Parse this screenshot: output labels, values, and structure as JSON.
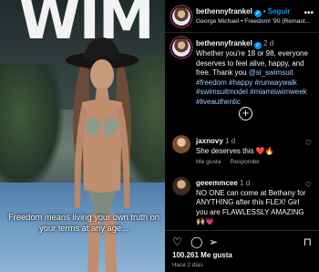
{
  "media": {
    "big_text": "WIM",
    "overlay_caption": "Freedom means living your own truth on your terms at any age..."
  },
  "post": {
    "username": "bethennyfrankel",
    "verified_icon": "verified-badge-icon",
    "separator": "•",
    "follow_label": "Seguir",
    "song": "George Michael • Freedom! '90 (Remast...",
    "more_icon": "more-options-icon"
  },
  "caption": {
    "username": "bethennyfrankel",
    "time": "2 d",
    "text": "Whether you're 18 or 98, everyone deserves to feel alive, happy, and free. Thank you",
    "mention": "@si_swimsuit",
    "hashtags": "#freedom #happy #runwaywalk #swimsuitmodel #miamiswimweek #liveauthentic"
  },
  "comments": [
    {
      "username": "jaxnovy",
      "text": "She deserves this ❤️🔥",
      "likes_label": "Me gusta",
      "reply_label": "Responder"
    },
    {
      "username": "geeemmcee",
      "text": "NO ONE can come at Bethany for ANYTHING after this FLEX! Girl you are FLAWLESSLY AMAZING 🙌🏼💗",
      "likes_label": "Me gusta",
      "reply_label": "Responder"
    }
  ],
  "actions": {
    "likes_count": "100.261",
    "likes_label": "Me gusta",
    "time_ago": "Hace 2 días"
  },
  "colors": {
    "accent": "#0095f6",
    "background": "#000000",
    "muted": "#a8a8a8"
  }
}
